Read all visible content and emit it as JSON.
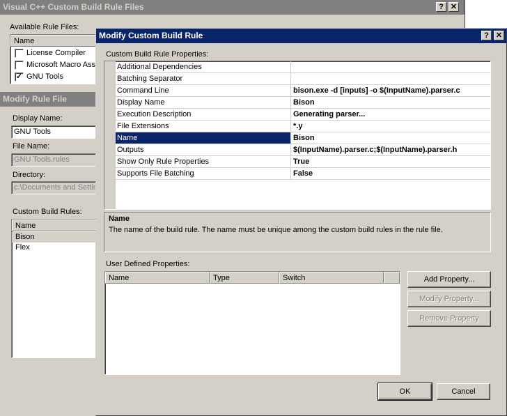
{
  "win_bg": {
    "title": "Visual C++ Custom Build Rule Files",
    "help": "?",
    "close": "✕",
    "available_label": "Available Rule Files:",
    "column_name": "Name",
    "rules": [
      {
        "label": "License Compiler",
        "checked": false
      },
      {
        "label": "Microsoft Macro Asse",
        "checked": false
      },
      {
        "label": "GNU Tools",
        "checked": true
      }
    ]
  },
  "win_mid": {
    "title": "Modify Rule File",
    "display_name_label": "Display Name:",
    "display_name_value": "GNU Tools",
    "file_name_label": "File Name:",
    "file_name_value": "GNU Tools.rules",
    "directory_label": "Directory:",
    "directory_value": "c:\\Documents and Settin",
    "custom_rules_label": "Custom Build Rules:",
    "column_name": "Name",
    "rules": [
      "Bison",
      "Flex"
    ]
  },
  "win_front": {
    "title": "Modify Custom Build Rule",
    "help": "?",
    "close": "✕",
    "props_label": "Custom Build Rule Properties:",
    "properties": [
      {
        "name": "Additional Dependencies",
        "value": ""
      },
      {
        "name": "Batching Separator",
        "value": ""
      },
      {
        "name": "Command Line",
        "value": "bison.exe -d [inputs] -o $(InputName).parser.c"
      },
      {
        "name": "Display Name",
        "value": "Bison"
      },
      {
        "name": "Execution Description",
        "value": "Generating parser..."
      },
      {
        "name": "File Extensions",
        "value": "*.y"
      },
      {
        "name": "Name",
        "value": "Bison",
        "selected": true
      },
      {
        "name": "Outputs",
        "value": "$(InputName).parser.c;$(InputName).parser.h"
      },
      {
        "name": "Show Only Rule Properties",
        "value": "True"
      },
      {
        "name": "Supports File Batching",
        "value": "False"
      }
    ],
    "desc_title": "Name",
    "desc_text": "The name of the build rule.  The name must be unique among the custom build rules in the rule file.",
    "user_props_label": "User Defined Properties:",
    "user_columns": [
      "Name",
      "Type",
      "Switch"
    ],
    "add_property": "Add Property...",
    "modify_property": "Modify Property...",
    "remove_property": "Remove Property",
    "ok": "OK",
    "cancel": "Cancel"
  },
  "colors": {
    "dialog": "#d4d0c8",
    "active_title": "#0a246a",
    "inactive_title": "#808080",
    "selection": "#0a246a"
  }
}
